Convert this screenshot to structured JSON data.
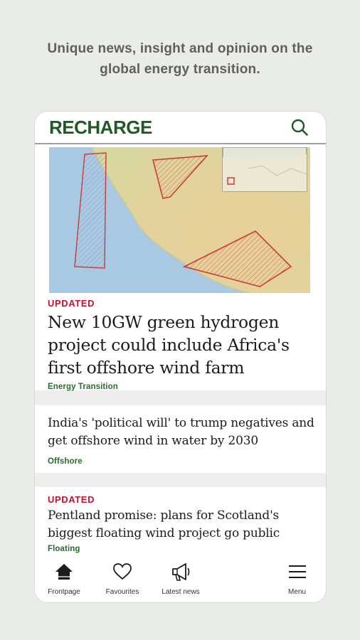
{
  "tagline": {
    "line1": "Unique news, insight and opinion on the",
    "line2": "global energy transition."
  },
  "header": {
    "logo": "RECHARGE",
    "search_icon": "search-icon"
  },
  "articles": [
    {
      "kicker": "UPDATED",
      "headline": "New 10GW green hydrogen project could include Africa's first offshore wind farm",
      "section": "Energy Transition",
      "image": "map-image"
    },
    {
      "kicker": "",
      "headline": "India's 'political will' to trump negatives and get offshore wind in water by 2030",
      "section": "Offshore"
    },
    {
      "kicker": "UPDATED",
      "headline": "Pentland promise: plans for Scotland's biggest floating wind project go public",
      "section": "Floating"
    }
  ],
  "nav": {
    "items": [
      {
        "label": "Frontpage",
        "icon": "home-icon"
      },
      {
        "label": "Favourites",
        "icon": "heart-icon"
      },
      {
        "label": "Latest news",
        "icon": "megaphone-icon"
      },
      {
        "label": "Menu",
        "icon": "menu-icon"
      }
    ]
  },
  "colors": {
    "brand": "#1f5a24",
    "kicker": "#c8102e",
    "section": "#2e6a2e",
    "background": "#e9ece8"
  }
}
